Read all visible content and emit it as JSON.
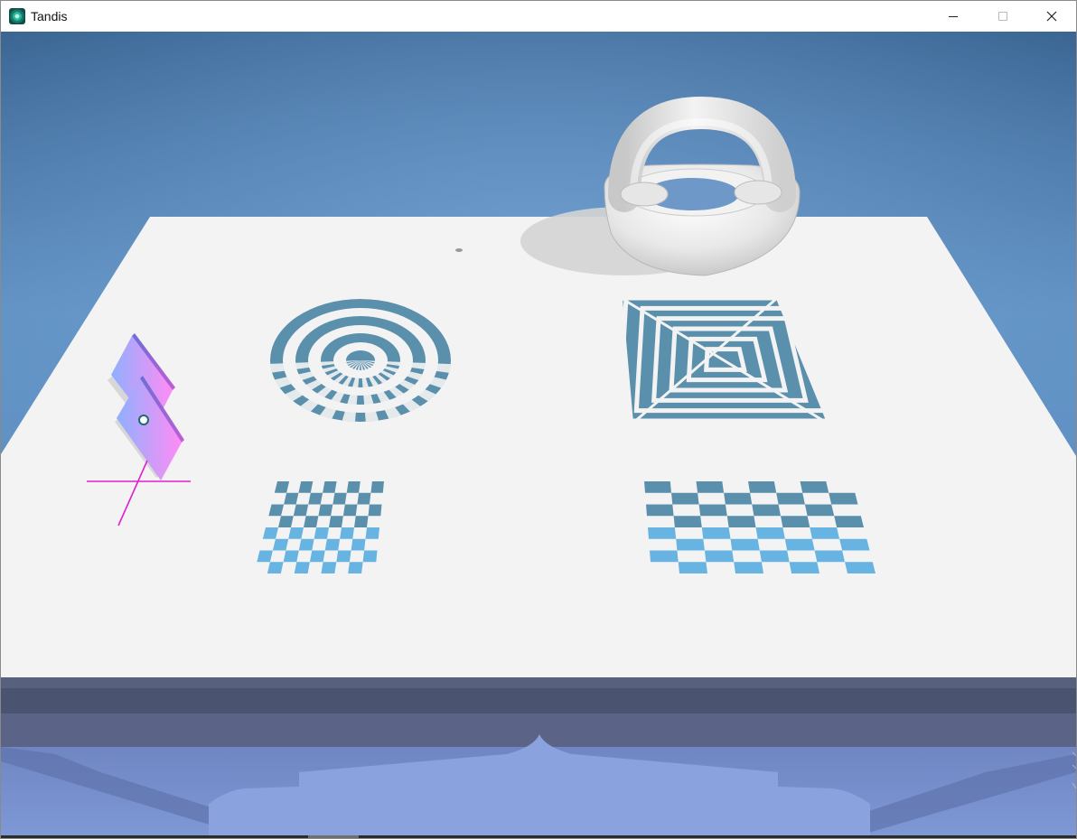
{
  "window": {
    "title": "Tandis",
    "icon": "tandis-app-icon",
    "controls": {
      "minimize": "minimize-icon",
      "maximize": "maximize-icon",
      "close": "close-icon"
    }
  },
  "scene": {
    "objects": [
      "pattern-circular-rings",
      "pattern-square-spiral",
      "pattern-checkerboard-small",
      "pattern-checkerboard-large",
      "torus-handle-model",
      "gradient-panel-widget",
      "axis-gizmo"
    ],
    "colors": {
      "sky_top": "#3a6795",
      "sky_bottom": "#6d99c8",
      "table": "#f3f3f3",
      "pattern": "#5b90ad",
      "pattern_light": "#67b4e2",
      "gizmo": "#e020d0",
      "panel_a": "#9db0ff",
      "panel_b": "#f08cff"
    }
  }
}
